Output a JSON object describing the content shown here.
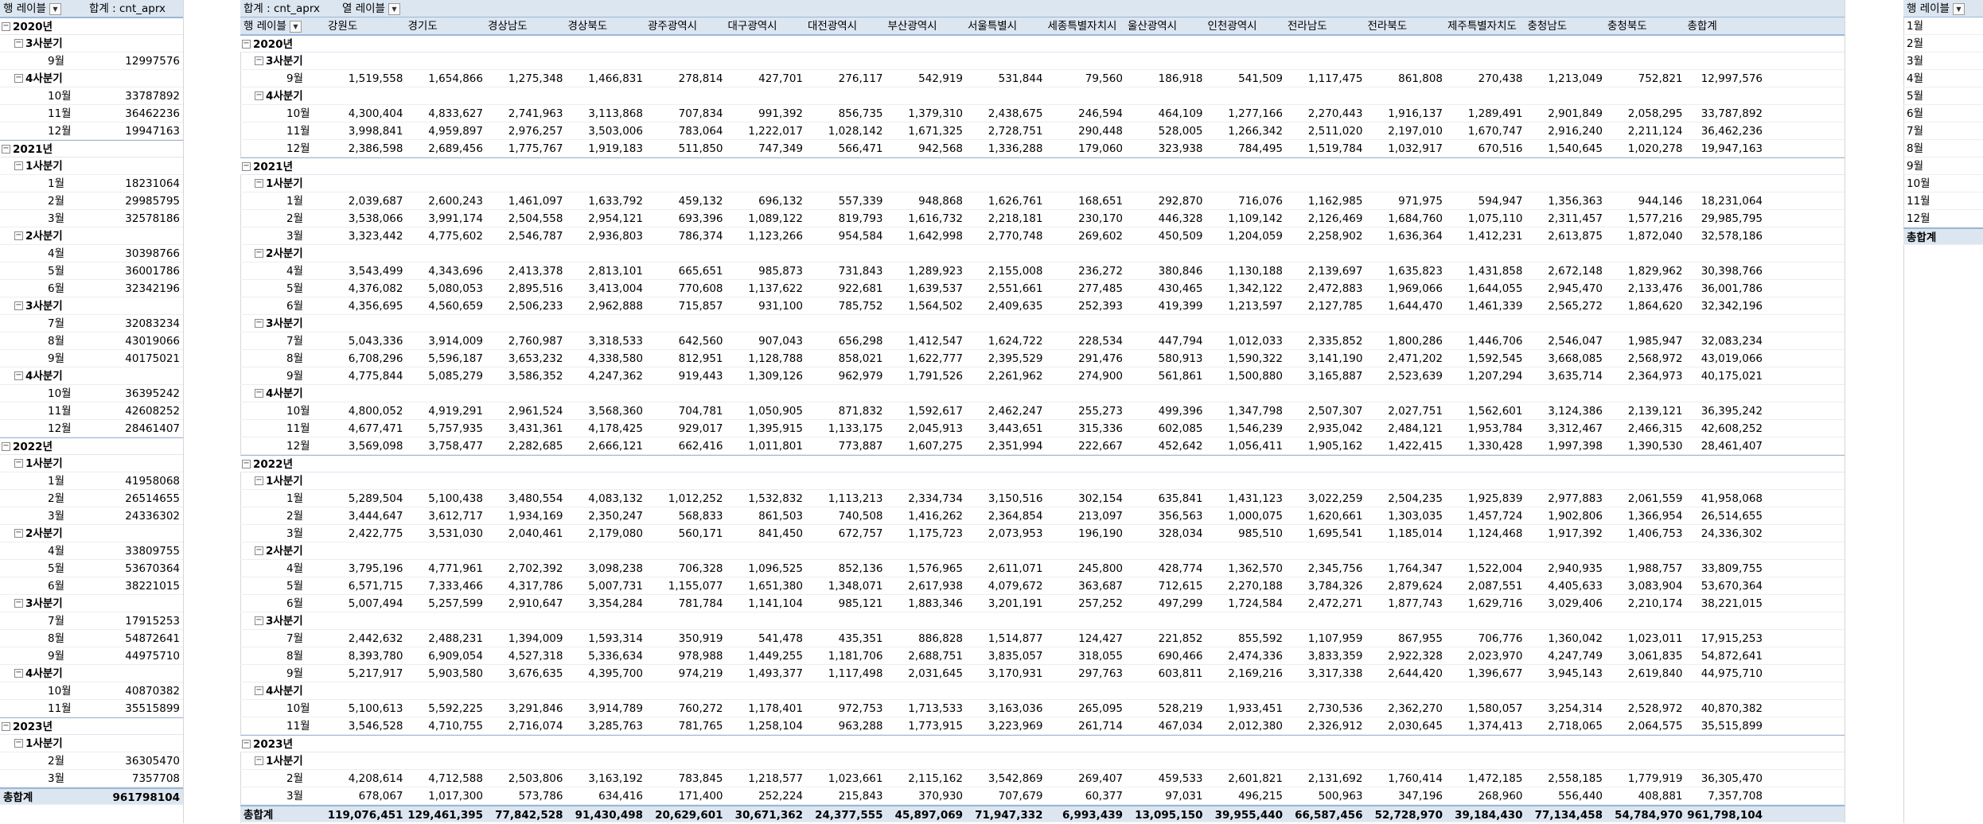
{
  "pivot1": {
    "header_row": "행 레이블",
    "header_value": "합계 : cnt_aprx",
    "grand_total_label": "총합계",
    "grand_total": "961798104",
    "rows": [
      {
        "t": "y",
        "label": "2020년"
      },
      {
        "t": "q",
        "label": "3사분기"
      },
      {
        "t": "m",
        "label": "9월",
        "value": "12997576"
      },
      {
        "t": "q",
        "label": "4사분기"
      },
      {
        "t": "m",
        "label": "10월",
        "value": "33787892"
      },
      {
        "t": "m",
        "label": "11월",
        "value": "36462236"
      },
      {
        "t": "m",
        "label": "12월",
        "value": "19947163"
      },
      {
        "t": "y",
        "label": "2021년"
      },
      {
        "t": "q",
        "label": "1사분기"
      },
      {
        "t": "m",
        "label": "1월",
        "value": "18231064"
      },
      {
        "t": "m",
        "label": "2월",
        "value": "29985795"
      },
      {
        "t": "m",
        "label": "3월",
        "value": "32578186"
      },
      {
        "t": "q",
        "label": "2사분기"
      },
      {
        "t": "m",
        "label": "4월",
        "value": "30398766"
      },
      {
        "t": "m",
        "label": "5월",
        "value": "36001786"
      },
      {
        "t": "m",
        "label": "6월",
        "value": "32342196"
      },
      {
        "t": "q",
        "label": "3사분기"
      },
      {
        "t": "m",
        "label": "7월",
        "value": "32083234"
      },
      {
        "t": "m",
        "label": "8월",
        "value": "43019066"
      },
      {
        "t": "m",
        "label": "9월",
        "value": "40175021"
      },
      {
        "t": "q",
        "label": "4사분기"
      },
      {
        "t": "m",
        "label": "10월",
        "value": "36395242"
      },
      {
        "t": "m",
        "label": "11월",
        "value": "42608252"
      },
      {
        "t": "m",
        "label": "12월",
        "value": "28461407"
      },
      {
        "t": "y",
        "label": "2022년"
      },
      {
        "t": "q",
        "label": "1사분기"
      },
      {
        "t": "m",
        "label": "1월",
        "value": "41958068"
      },
      {
        "t": "m",
        "label": "2월",
        "value": "26514655"
      },
      {
        "t": "m",
        "label": "3월",
        "value": "24336302"
      },
      {
        "t": "q",
        "label": "2사분기"
      },
      {
        "t": "m",
        "label": "4월",
        "value": "33809755"
      },
      {
        "t": "m",
        "label": "5월",
        "value": "53670364"
      },
      {
        "t": "m",
        "label": "6월",
        "value": "38221015"
      },
      {
        "t": "q",
        "label": "3사분기"
      },
      {
        "t": "m",
        "label": "7월",
        "value": "17915253"
      },
      {
        "t": "m",
        "label": "8월",
        "value": "54872641"
      },
      {
        "t": "m",
        "label": "9월",
        "value": "44975710"
      },
      {
        "t": "q",
        "label": "4사분기"
      },
      {
        "t": "m",
        "label": "10월",
        "value": "40870382"
      },
      {
        "t": "m",
        "label": "11월",
        "value": "35515899"
      },
      {
        "t": "y",
        "label": "2023년"
      },
      {
        "t": "q",
        "label": "1사분기"
      },
      {
        "t": "m",
        "label": "2월",
        "value": "36305470"
      },
      {
        "t": "m",
        "label": "3월",
        "value": "7357708"
      }
    ]
  },
  "pivot2": {
    "value_label": "합계 : cnt_aprx",
    "column_label": "열 레이블",
    "row_label": "행 레이블",
    "grand_total_label": "총합계",
    "columns": [
      "강원도",
      "경기도",
      "경상남도",
      "경상북도",
      "광주광역시",
      "대구광역시",
      "대전광역시",
      "부산광역시",
      "서울특별시",
      "세종특별자치시",
      "울산광역시",
      "인천광역시",
      "전라남도",
      "전라북도",
      "제주특별자치도",
      "충청남도",
      "충청북도",
      "총합계"
    ],
    "rows": [
      {
        "t": "y",
        "label": "2020년"
      },
      {
        "t": "q",
        "label": "3사분기"
      },
      {
        "t": "m",
        "label": "9월",
        "v": [
          "1,519,558",
          "1,654,866",
          "1,275,348",
          "1,466,831",
          "278,814",
          "427,701",
          "276,117",
          "542,919",
          "531,844",
          "79,560",
          "186,918",
          "541,509",
          "1,117,475",
          "861,808",
          "270,438",
          "1,213,049",
          "752,821",
          "12,997,576"
        ]
      },
      {
        "t": "q",
        "label": "4사분기"
      },
      {
        "t": "m",
        "label": "10월",
        "v": [
          "4,300,404",
          "4,833,627",
          "2,741,963",
          "3,113,868",
          "707,834",
          "991,392",
          "856,735",
          "1,379,310",
          "2,438,675",
          "246,594",
          "464,109",
          "1,277,166",
          "2,270,443",
          "1,916,137",
          "1,289,491",
          "2,901,849",
          "2,058,295",
          "33,787,892"
        ]
      },
      {
        "t": "m",
        "label": "11월",
        "v": [
          "3,998,841",
          "4,959,897",
          "2,976,257",
          "3,503,006",
          "783,064",
          "1,222,017",
          "1,028,142",
          "1,671,325",
          "2,728,751",
          "290,448",
          "528,005",
          "1,266,342",
          "2,511,020",
          "2,197,010",
          "1,670,747",
          "2,916,240",
          "2,211,124",
          "36,462,236"
        ]
      },
      {
        "t": "m",
        "label": "12월",
        "v": [
          "2,386,598",
          "2,689,456",
          "1,775,767",
          "1,919,183",
          "511,850",
          "747,349",
          "566,471",
          "942,568",
          "1,336,288",
          "179,060",
          "323,938",
          "784,495",
          "1,519,784",
          "1,032,917",
          "670,516",
          "1,540,645",
          "1,020,278",
          "19,947,163"
        ]
      },
      {
        "t": "y",
        "label": "2021년"
      },
      {
        "t": "q",
        "label": "1사분기"
      },
      {
        "t": "m",
        "label": "1월",
        "v": [
          "2,039,687",
          "2,600,243",
          "1,461,097",
          "1,633,792",
          "459,132",
          "696,132",
          "557,339",
          "948,868",
          "1,626,761",
          "168,651",
          "292,870",
          "716,076",
          "1,162,985",
          "971,975",
          "594,947",
          "1,356,363",
          "944,146",
          "18,231,064"
        ]
      },
      {
        "t": "m",
        "label": "2월",
        "v": [
          "3,538,066",
          "3,991,174",
          "2,504,558",
          "2,954,121",
          "693,396",
          "1,089,122",
          "819,793",
          "1,616,732",
          "2,218,181",
          "230,170",
          "446,328",
          "1,109,142",
          "2,126,469",
          "1,684,760",
          "1,075,110",
          "2,311,457",
          "1,577,216",
          "29,985,795"
        ]
      },
      {
        "t": "m",
        "label": "3월",
        "v": [
          "3,323,442",
          "4,775,602",
          "2,546,787",
          "2,936,803",
          "786,374",
          "1,123,266",
          "954,584",
          "1,642,998",
          "2,770,748",
          "269,602",
          "450,509",
          "1,204,059",
          "2,258,902",
          "1,636,364",
          "1,412,231",
          "2,613,875",
          "1,872,040",
          "32,578,186"
        ]
      },
      {
        "t": "q",
        "label": "2사분기"
      },
      {
        "t": "m",
        "label": "4월",
        "v": [
          "3,543,499",
          "4,343,696",
          "2,413,378",
          "2,813,101",
          "665,651",
          "985,873",
          "731,843",
          "1,289,923",
          "2,155,008",
          "236,272",
          "380,846",
          "1,130,188",
          "2,139,697",
          "1,635,823",
          "1,431,858",
          "2,672,148",
          "1,829,962",
          "30,398,766"
        ]
      },
      {
        "t": "m",
        "label": "5월",
        "v": [
          "4,376,082",
          "5,080,053",
          "2,895,516",
          "3,413,004",
          "770,608",
          "1,137,622",
          "922,681",
          "1,639,537",
          "2,551,661",
          "277,485",
          "430,465",
          "1,342,122",
          "2,472,883",
          "1,969,066",
          "1,644,055",
          "2,945,470",
          "2,133,476",
          "36,001,786"
        ]
      },
      {
        "t": "m",
        "label": "6월",
        "v": [
          "4,356,695",
          "4,560,659",
          "2,506,233",
          "2,962,888",
          "715,857",
          "931,100",
          "785,752",
          "1,564,502",
          "2,409,635",
          "252,393",
          "419,399",
          "1,213,597",
          "2,127,785",
          "1,644,470",
          "1,461,339",
          "2,565,272",
          "1,864,620",
          "32,342,196"
        ]
      },
      {
        "t": "q",
        "label": "3사분기"
      },
      {
        "t": "m",
        "label": "7월",
        "v": [
          "5,043,336",
          "3,914,009",
          "2,760,987",
          "3,318,533",
          "642,560",
          "907,043",
          "656,298",
          "1,412,547",
          "1,624,722",
          "228,534",
          "447,794",
          "1,012,033",
          "2,335,852",
          "1,800,286",
          "1,446,706",
          "2,546,047",
          "1,985,947",
          "32,083,234"
        ]
      },
      {
        "t": "m",
        "label": "8월",
        "v": [
          "6,708,296",
          "5,596,187",
          "3,653,232",
          "4,338,580",
          "812,951",
          "1,128,788",
          "858,021",
          "1,622,777",
          "2,395,529",
          "291,476",
          "580,913",
          "1,590,322",
          "3,141,190",
          "2,471,202",
          "1,592,545",
          "3,668,085",
          "2,568,972",
          "43,019,066"
        ]
      },
      {
        "t": "m",
        "label": "9월",
        "v": [
          "4,775,844",
          "5,085,279",
          "3,586,352",
          "4,247,362",
          "919,443",
          "1,309,126",
          "962,979",
          "1,791,526",
          "2,261,962",
          "274,900",
          "561,861",
          "1,500,880",
          "3,165,887",
          "2,523,639",
          "1,207,294",
          "3,635,714",
          "2,364,973",
          "40,175,021"
        ]
      },
      {
        "t": "q",
        "label": "4사분기"
      },
      {
        "t": "m",
        "label": "10월",
        "v": [
          "4,800,052",
          "4,919,291",
          "2,961,524",
          "3,568,360",
          "704,781",
          "1,050,905",
          "871,832",
          "1,592,617",
          "2,462,247",
          "255,273",
          "499,396",
          "1,347,798",
          "2,507,307",
          "2,027,751",
          "1,562,601",
          "3,124,386",
          "2,139,121",
          "36,395,242"
        ]
      },
      {
        "t": "m",
        "label": "11월",
        "v": [
          "4,677,471",
          "5,757,935",
          "3,431,361",
          "4,178,425",
          "929,017",
          "1,395,915",
          "1,133,175",
          "2,045,913",
          "3,443,651",
          "315,336",
          "602,085",
          "1,546,239",
          "2,935,042",
          "2,484,121",
          "1,953,784",
          "3,312,467",
          "2,466,315",
          "42,608,252"
        ]
      },
      {
        "t": "m",
        "label": "12월",
        "v": [
          "3,569,098",
          "3,758,477",
          "2,282,685",
          "2,666,121",
          "662,416",
          "1,011,801",
          "773,887",
          "1,607,275",
          "2,351,994",
          "222,667",
          "452,642",
          "1,056,411",
          "1,905,162",
          "1,422,415",
          "1,330,428",
          "1,997,398",
          "1,390,530",
          "28,461,407"
        ]
      },
      {
        "t": "y",
        "label": "2022년"
      },
      {
        "t": "q",
        "label": "1사분기"
      },
      {
        "t": "m",
        "label": "1월",
        "v": [
          "5,289,504",
          "5,100,438",
          "3,480,554",
          "4,083,132",
          "1,012,252",
          "1,532,832",
          "1,113,213",
          "2,334,734",
          "3,150,516",
          "302,154",
          "635,841",
          "1,431,123",
          "3,022,259",
          "2,504,235",
          "1,925,839",
          "2,977,883",
          "2,061,559",
          "41,958,068"
        ]
      },
      {
        "t": "m",
        "label": "2월",
        "v": [
          "3,444,647",
          "3,612,717",
          "1,934,169",
          "2,350,247",
          "568,833",
          "861,503",
          "740,508",
          "1,416,262",
          "2,364,854",
          "213,097",
          "356,563",
          "1,000,075",
          "1,620,661",
          "1,303,035",
          "1,457,724",
          "1,902,806",
          "1,366,954",
          "26,514,655"
        ]
      },
      {
        "t": "m",
        "label": "3월",
        "v": [
          "2,422,775",
          "3,531,030",
          "2,040,461",
          "2,179,080",
          "560,171",
          "841,450",
          "672,757",
          "1,175,723",
          "2,073,953",
          "196,190",
          "328,034",
          "985,510",
          "1,695,541",
          "1,185,014",
          "1,124,468",
          "1,917,392",
          "1,406,753",
          "24,336,302"
        ]
      },
      {
        "t": "q",
        "label": "2사분기"
      },
      {
        "t": "m",
        "label": "4월",
        "v": [
          "3,795,196",
          "4,771,961",
          "2,702,392",
          "3,098,238",
          "706,328",
          "1,096,525",
          "852,136",
          "1,576,965",
          "2,611,071",
          "245,800",
          "428,774",
          "1,362,570",
          "2,345,756",
          "1,764,347",
          "1,522,004",
          "2,940,935",
          "1,988,757",
          "33,809,755"
        ]
      },
      {
        "t": "m",
        "label": "5월",
        "v": [
          "6,571,715",
          "7,333,466",
          "4,317,786",
          "5,007,731",
          "1,155,077",
          "1,651,380",
          "1,348,071",
          "2,617,938",
          "4,079,672",
          "363,687",
          "712,615",
          "2,270,188",
          "3,784,326",
          "2,879,624",
          "2,087,551",
          "4,405,633",
          "3,083,904",
          "53,670,364"
        ]
      },
      {
        "t": "m",
        "label": "6월",
        "v": [
          "5,007,494",
          "5,257,599",
          "2,910,647",
          "3,354,284",
          "781,784",
          "1,141,104",
          "985,121",
          "1,883,346",
          "3,201,191",
          "257,252",
          "497,299",
          "1,724,584",
          "2,472,271",
          "1,877,743",
          "1,629,716",
          "3,029,406",
          "2,210,174",
          "38,221,015"
        ]
      },
      {
        "t": "q",
        "label": "3사분기"
      },
      {
        "t": "m",
        "label": "7월",
        "v": [
          "2,442,632",
          "2,488,231",
          "1,394,009",
          "1,593,314",
          "350,919",
          "541,478",
          "435,351",
          "886,828",
          "1,514,877",
          "124,427",
          "221,852",
          "855,592",
          "1,107,959",
          "867,955",
          "706,776",
          "1,360,042",
          "1,023,011",
          "17,915,253"
        ]
      },
      {
        "t": "m",
        "label": "8월",
        "v": [
          "8,393,780",
          "6,909,054",
          "4,527,318",
          "5,336,634",
          "978,988",
          "1,449,255",
          "1,181,706",
          "2,688,751",
          "3,835,057",
          "318,055",
          "690,466",
          "2,474,336",
          "3,833,359",
          "2,922,328",
          "2,023,970",
          "4,247,749",
          "3,061,835",
          "54,872,641"
        ]
      },
      {
        "t": "m",
        "label": "9월",
        "v": [
          "5,217,917",
          "5,903,580",
          "3,676,635",
          "4,395,700",
          "974,219",
          "1,493,377",
          "1,117,498",
          "2,031,645",
          "3,170,931",
          "297,763",
          "603,811",
          "2,169,216",
          "3,317,338",
          "2,644,420",
          "1,396,677",
          "3,945,143",
          "2,619,840",
          "44,975,710"
        ]
      },
      {
        "t": "q",
        "label": "4사분기"
      },
      {
        "t": "m",
        "label": "10월",
        "v": [
          "5,100,613",
          "5,592,225",
          "3,291,846",
          "3,914,789",
          "760,272",
          "1,178,401",
          "972,753",
          "1,713,533",
          "3,163,036",
          "265,095",
          "528,219",
          "1,933,451",
          "2,730,536",
          "2,362,270",
          "1,580,057",
          "3,254,314",
          "2,528,972",
          "40,870,382"
        ]
      },
      {
        "t": "m",
        "label": "11월",
        "v": [
          "3,546,528",
          "4,710,755",
          "2,716,074",
          "3,285,763",
          "781,765",
          "1,258,104",
          "963,288",
          "1,773,915",
          "3,223,969",
          "261,714",
          "467,034",
          "2,012,380",
          "2,326,912",
          "2,030,645",
          "1,374,413",
          "2,718,065",
          "2,064,575",
          "35,515,899"
        ]
      },
      {
        "t": "y",
        "label": "2023년"
      },
      {
        "t": "q",
        "label": "1사분기"
      },
      {
        "t": "m",
        "label": "2월",
        "v": [
          "4,208,614",
          "4,712,588",
          "2,503,806",
          "3,163,192",
          "783,845",
          "1,218,577",
          "1,023,661",
          "2,115,162",
          "3,542,869",
          "269,407",
          "459,533",
          "2,601,821",
          "2,131,692",
          "1,760,414",
          "1,472,185",
          "2,558,185",
          "1,779,919",
          "36,305,470"
        ]
      },
      {
        "t": "m",
        "label": "3월",
        "v": [
          "678,067",
          "1,017,300",
          "573,786",
          "634,416",
          "171,400",
          "252,224",
          "215,843",
          "370,930",
          "707,679",
          "60,377",
          "97,031",
          "496,215",
          "500,963",
          "347,196",
          "268,960",
          "556,440",
          "408,881",
          "7,357,708"
        ]
      }
    ],
    "grand_totals": [
      "119,076,451",
      "129,461,395",
      "77,842,528",
      "91,430,498",
      "20,629,601",
      "30,671,362",
      "24,377,555",
      "45,897,069",
      "71,947,332",
      "6,993,439",
      "13,095,150",
      "39,955,440",
      "66,587,456",
      "52,728,970",
      "39,184,430",
      "77,134,458",
      "54,784,970",
      "961,798,104"
    ]
  },
  "pivot3": {
    "header": "행 레이블",
    "items": [
      "1월",
      "2월",
      "3월",
      "4월",
      "5월",
      "6월",
      "7월",
      "8월",
      "9월",
      "10월",
      "11월",
      "12월"
    ],
    "grand_total_label": "총합계"
  },
  "icons": {
    "dropdown": "dropdown-arrow-icon",
    "collapse": "collapse-minus-icon"
  }
}
